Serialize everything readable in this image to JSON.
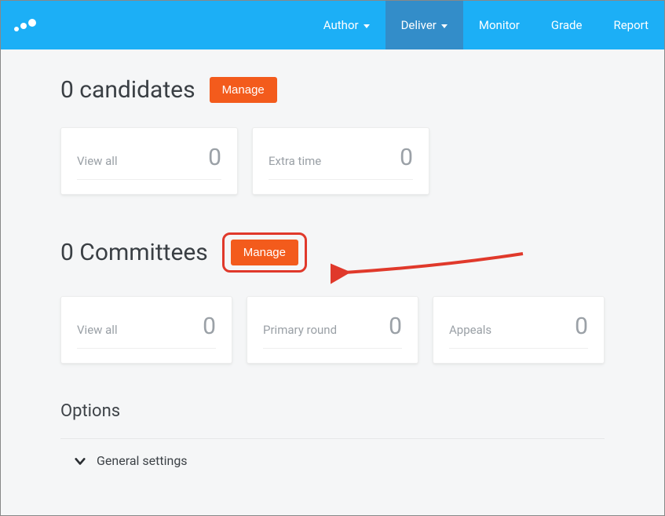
{
  "nav": {
    "items": [
      {
        "label": "Author",
        "dropdown": true,
        "active": false
      },
      {
        "label": "Deliver",
        "dropdown": true,
        "active": true
      },
      {
        "label": "Monitor",
        "dropdown": false,
        "active": false
      },
      {
        "label": "Grade",
        "dropdown": false,
        "active": false
      },
      {
        "label": "Report",
        "dropdown": false,
        "active": false
      }
    ]
  },
  "candidates": {
    "title": "0 candidates",
    "manage_label": "Manage",
    "cards": [
      {
        "label": "View all",
        "value": "0"
      },
      {
        "label": "Extra time",
        "value": "0"
      }
    ]
  },
  "committees": {
    "title": "0 Committees",
    "manage_label": "Manage",
    "cards": [
      {
        "label": "View all",
        "value": "0"
      },
      {
        "label": "Primary round",
        "value": "0"
      },
      {
        "label": "Appeals",
        "value": "0"
      }
    ]
  },
  "options": {
    "title": "Options",
    "general_settings_label": "General settings"
  }
}
